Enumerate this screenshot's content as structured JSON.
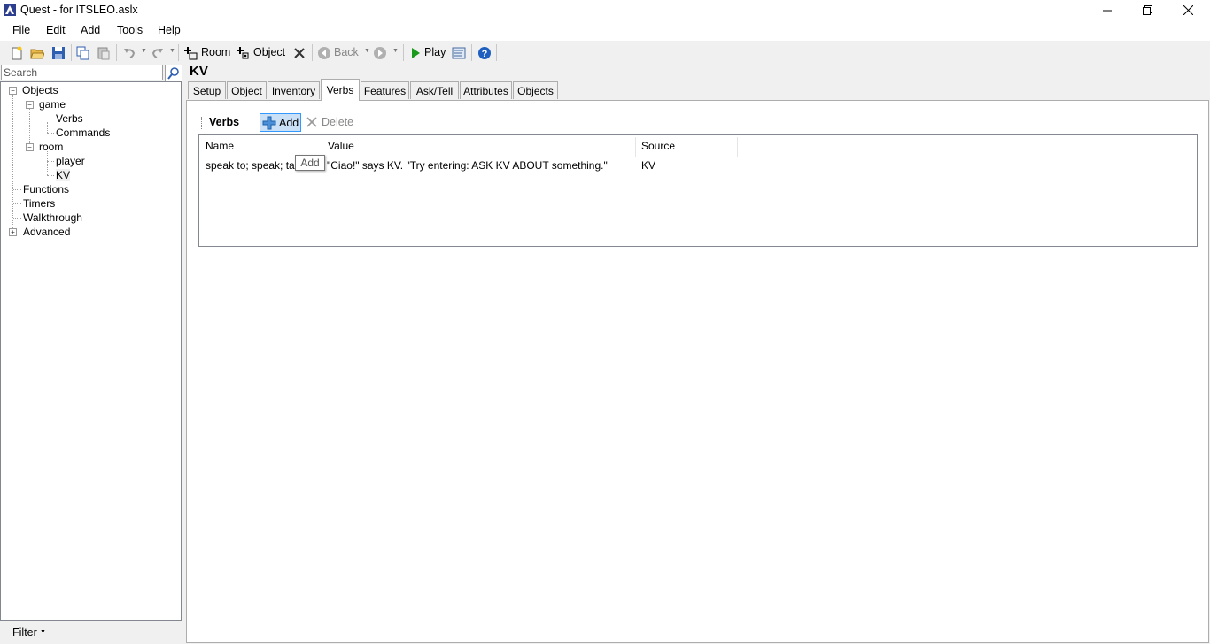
{
  "window": {
    "title": "Quest - for ITSLEO.aslx"
  },
  "menu": {
    "items": [
      "File",
      "Edit",
      "Add",
      "Tools",
      "Help"
    ]
  },
  "toolbar": {
    "room_label": "Room",
    "object_label": "Object",
    "back_label": "Back",
    "play_label": "Play"
  },
  "search": {
    "placeholder": "Search"
  },
  "tree": {
    "objects": "Objects",
    "game": "game",
    "verbs": "Verbs",
    "commands": "Commands",
    "room": "room",
    "player": "player",
    "kv": "KV",
    "functions": "Functions",
    "timers": "Timers",
    "walkthrough": "Walkthrough",
    "advanced": "Advanced"
  },
  "filter": {
    "label": "Filter"
  },
  "editor": {
    "title": "KV",
    "tabs": [
      "Setup",
      "Object",
      "Inventory",
      "Verbs",
      "Features",
      "Ask/Tell",
      "Attributes",
      "Objects"
    ],
    "active_tab": "Verbs",
    "section_label": "Verbs",
    "add_label": "Add",
    "delete_label": "Delete",
    "columns": [
      "Name",
      "Value",
      "Source"
    ],
    "rows": [
      {
        "name": "speak to; speak; talk",
        "value": "\"Ciao!\" says KV.  \"Try entering: ASK KV ABOUT something.\"",
        "source": "KV"
      }
    ],
    "tooltip": "Add"
  },
  "colors": {
    "accent": "#3399ff",
    "add_button_bg": "#c9e0f7",
    "play_green": "#1a9a1a",
    "help_blue": "#1e5fbf"
  }
}
